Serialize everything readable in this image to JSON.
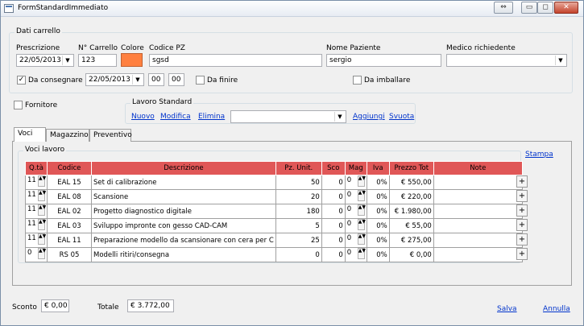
{
  "window": {
    "title": "FormStandardImmediato",
    "btn_restore": "⇔",
    "btn_min": "▭",
    "btn_max": "◻",
    "btn_close": "✕"
  },
  "dati_carrello": {
    "group_title": "Dati carrello",
    "prescrizione_label": "Prescrizione",
    "prescrizione_value": "22/05/2013",
    "ncarrello_label": "N° Carrello",
    "ncarrello_value": "123",
    "colore_label": "Colore",
    "colore_value": "#ff8040",
    "codicepz_label": "Codice PZ",
    "codicepz_value": "sgsd",
    "nome_label": "Nome Paziente",
    "nome_value": "sergio",
    "medico_label": "Medico richiedente",
    "medico_value": "",
    "consegnare_label": "Da consegnare",
    "consegnare_checked": "✓",
    "consegna_date": "22/05/2013",
    "ora": "00",
    "minuti": "00",
    "finire_label": "Da finire",
    "imballare_label": "Da imballare"
  },
  "fornitore_label": "Fornitore",
  "lavoro_standard": {
    "group_title": "Lavoro Standard",
    "nuovo": "Nuovo",
    "modifica": "Modifica",
    "elimina": "Elimina",
    "combo_value": "",
    "aggiungi": "Aggiungi",
    "svuota": "Svuota"
  },
  "tabs": [
    "Voci",
    "Magazzino",
    "Preventivo"
  ],
  "voci": {
    "group_title": "Voci lavoro",
    "stampa": "Stampa",
    "columns": [
      "Q.tà",
      "Codice",
      "Descrizione",
      "Pz. Unit.",
      "Sco",
      "Mag",
      "Iva",
      "Prezzo Tot",
      "Note"
    ],
    "rows": [
      {
        "qta": "11",
        "codice": "EAL 15",
        "descrizione": "Set di calibrazione",
        "pz": "50",
        "sco": "0",
        "mag": "0",
        "iva": "0%",
        "prezzo": "€ 550,00",
        "note": ""
      },
      {
        "qta": "11",
        "codice": "EAL 08",
        "descrizione": "Scansione",
        "pz": "20",
        "sco": "0",
        "mag": "0",
        "iva": "0%",
        "prezzo": "€ 220,00",
        "note": ""
      },
      {
        "qta": "11",
        "codice": "EAL 02",
        "descrizione": "Progetto diagnostico digitale",
        "pz": "180",
        "sco": "0",
        "mag": "0",
        "iva": "0%",
        "prezzo": "€ 1.980,00",
        "note": ""
      },
      {
        "qta": "11",
        "codice": "EAL 03",
        "descrizione": "Sviluppo impronte con gesso CAD-CAM",
        "pz": "5",
        "sco": "0",
        "mag": "0",
        "iva": "0%",
        "prezzo": "€ 55,00",
        "note": ""
      },
      {
        "qta": "11",
        "codice": "EAL 11",
        "descrizione": "Preparazione modello da scansionare con cera per C",
        "pz": "25",
        "sco": "0",
        "mag": "0",
        "iva": "0%",
        "prezzo": "€ 275,00",
        "note": ""
      },
      {
        "qta": "0",
        "codice": "RS 05",
        "descrizione": "Modelli ritiri/consegna",
        "pz": "0",
        "sco": "0",
        "mag": "0",
        "iva": "0%",
        "prezzo": "€ 0,00",
        "note": ""
      }
    ],
    "plus": "+"
  },
  "footer": {
    "sconto_label": "Sconto",
    "sconto_value": "€ 0,00",
    "totale_label": "Totale",
    "totale_value": "€ 3.772,00",
    "salva": "Salva",
    "annulla": "Annulla"
  }
}
